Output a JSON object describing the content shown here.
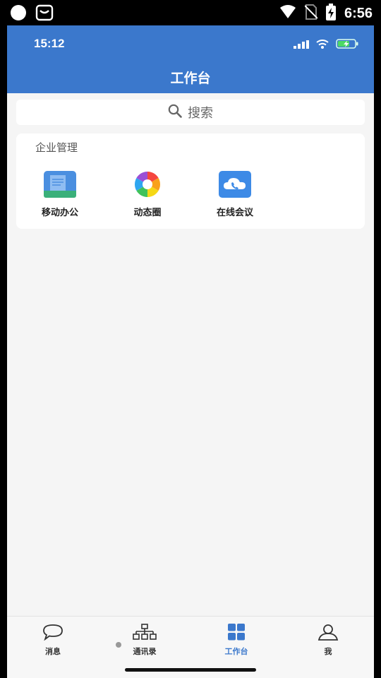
{
  "system_bar": {
    "time": "6:56"
  },
  "app_status_bar": {
    "time": "15:12"
  },
  "header": {
    "title": "工作台"
  },
  "search": {
    "label": "搜索"
  },
  "enterprise_section": {
    "title": "企业管理",
    "apps": [
      {
        "label": "移动办公",
        "icon": "document-icon"
      },
      {
        "label": "动态圈",
        "icon": "aperture-icon"
      },
      {
        "label": "在线会议",
        "icon": "cloud-phone-icon"
      }
    ]
  },
  "tabbar": {
    "tabs": [
      {
        "label": "消息",
        "icon": "chat-bubble-icon",
        "active": false
      },
      {
        "label": "通讯录",
        "icon": "org-chart-icon",
        "active": false
      },
      {
        "label": "工作台",
        "icon": "grid-icon",
        "active": true
      },
      {
        "label": "我",
        "icon": "person-icon",
        "active": false
      }
    ]
  },
  "colors": {
    "primary": "#3b78cc",
    "background": "#f5f5f5"
  }
}
